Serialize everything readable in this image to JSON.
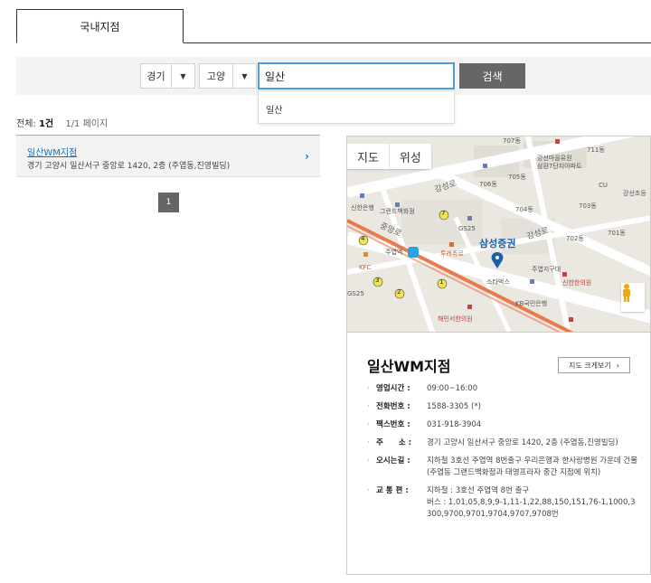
{
  "tabs": [
    {
      "label": "국내지점",
      "active": true
    }
  ],
  "search": {
    "province": "경기",
    "city": "고양",
    "query": "일산",
    "button_label": "검색",
    "suggestions": [
      "일산"
    ]
  },
  "summary": {
    "total_label": "전체:",
    "total_count": "1건",
    "pages": "1/1 페이지"
  },
  "results": [
    {
      "name": "일산WM지점",
      "address": "경기 고양시 일산서구 중앙로 1420, 2층 (주엽동,진영빌딩)"
    }
  ],
  "pagination": {
    "current": "1"
  },
  "map": {
    "toggle_map": "지도",
    "toggle_satellite": "위성",
    "labels": {
      "samsung": "삼성증권",
      "starbucks": "스타벅스",
      "grand_dept": "그랜드백화점",
      "gs25_a": "GS25",
      "gs25_b": "GS25",
      "juyeop_station": "주엽역",
      "twosome": "투레쥬르",
      "kfc": "KFC",
      "shinhan": "신한은행",
      "kb": "KB국민은행",
      "shinhan_clinic": "신한한의원",
      "juyeop_office": "주엽지구대",
      "gangseon_kinder": "강선마을유원\n삼환7단지아파트",
      "gangseon_school": "강선초등",
      "haemin": "해민서한의원",
      "cu": "CU",
      "gangseongro_1": "강성로",
      "gangseongro_2": "강성로",
      "jungangro": "중앙로",
      "b707": "707동",
      "b711": "711동",
      "b705": "705동",
      "b706": "706동",
      "b703": "703동",
      "b704": "704동",
      "b702": "702동",
      "b701": "701동",
      "exit_7": "7",
      "exit_4": "4",
      "exit_3": "3",
      "exit_2": "2",
      "exit_1": "1"
    }
  },
  "branch": {
    "name": "일산WM지점",
    "map_large_button": "지도 크게보기",
    "hours_label": "영업시간 :",
    "hours": "09:00~16:00",
    "phone_label": "전화번호 :",
    "phone": "1588-3305 (*)",
    "fax_label": "팩스번호 :",
    "fax": "031-918-3904",
    "address_label": "주　　소 :",
    "address": "경기 고양시 일산서구 중앙로 1420, 2층 (주엽동,진영빌딩)",
    "directions_label": "오시는길 :",
    "directions": "지하철 3호선 주엽역 8번출구 우리은행과 한사랑병원 가운데 건물(주엽동 그랜드백화점과 태영프라자 중간 지점에 위치)",
    "transport_label": "교 통 편 :",
    "transport_subway": "지하철 : 3호선 주엽역 8번 출구",
    "transport_bus": "버스 : 1,01,05,8,9,9-1,11-1,22,88,150,151,76-1,1000,3300,9700,9701,9704,9707,9708번"
  },
  "colors": {
    "accent_blue": "#1a6fc4",
    "focus_border": "#4a9fd8",
    "button_gray": "#666666"
  }
}
